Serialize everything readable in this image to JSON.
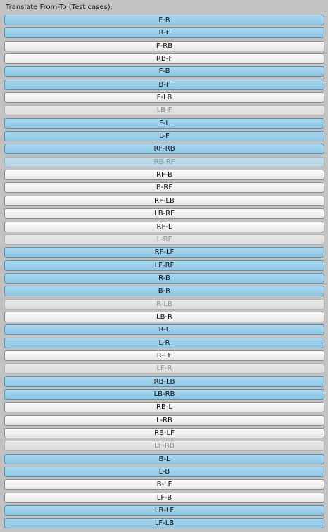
{
  "header": {
    "title": "Translate From-To (Test cases):"
  },
  "buttons": [
    {
      "label": "F-R",
      "state": "active"
    },
    {
      "label": "R-F",
      "state": "active"
    },
    {
      "label": "F-RB",
      "state": "normal"
    },
    {
      "label": "RB-F",
      "state": "normal"
    },
    {
      "label": "F-B",
      "state": "active"
    },
    {
      "label": "B-F",
      "state": "active"
    },
    {
      "label": "F-LB",
      "state": "normal"
    },
    {
      "label": "LB-F",
      "state": "disabled"
    },
    {
      "label": "F-L",
      "state": "active"
    },
    {
      "label": "L-F",
      "state": "active"
    },
    {
      "label": "RF-RB",
      "state": "active"
    },
    {
      "label": "RB-RF",
      "state": "active-disabled"
    },
    {
      "label": "RF-B",
      "state": "normal"
    },
    {
      "label": "B-RF",
      "state": "normal"
    },
    {
      "label": "RF-LB",
      "state": "normal"
    },
    {
      "label": "LB-RF",
      "state": "normal"
    },
    {
      "label": "RF-L",
      "state": "normal"
    },
    {
      "label": "L-RF",
      "state": "disabled"
    },
    {
      "label": "RF-LF",
      "state": "active"
    },
    {
      "label": "LF-RF",
      "state": "active"
    },
    {
      "label": "R-B",
      "state": "active"
    },
    {
      "label": "B-R",
      "state": "active"
    },
    {
      "label": "R-LB",
      "state": "disabled"
    },
    {
      "label": "LB-R",
      "state": "normal"
    },
    {
      "label": "R-L",
      "state": "active"
    },
    {
      "label": "L-R",
      "state": "active"
    },
    {
      "label": "R-LF",
      "state": "normal"
    },
    {
      "label": "LF-R",
      "state": "disabled"
    },
    {
      "label": "RB-LB",
      "state": "active"
    },
    {
      "label": "LB-RB",
      "state": "active"
    },
    {
      "label": "RB-L",
      "state": "normal"
    },
    {
      "label": "L-RB",
      "state": "normal"
    },
    {
      "label": "RB-LF",
      "state": "normal"
    },
    {
      "label": "LF-RB",
      "state": "disabled"
    },
    {
      "label": "B-L",
      "state": "active"
    },
    {
      "label": "L-B",
      "state": "active"
    },
    {
      "label": "B-LF",
      "state": "normal"
    },
    {
      "label": "LF-B",
      "state": "normal"
    },
    {
      "label": "LB-LF",
      "state": "active"
    },
    {
      "label": "LF-LB",
      "state": "active"
    }
  ]
}
